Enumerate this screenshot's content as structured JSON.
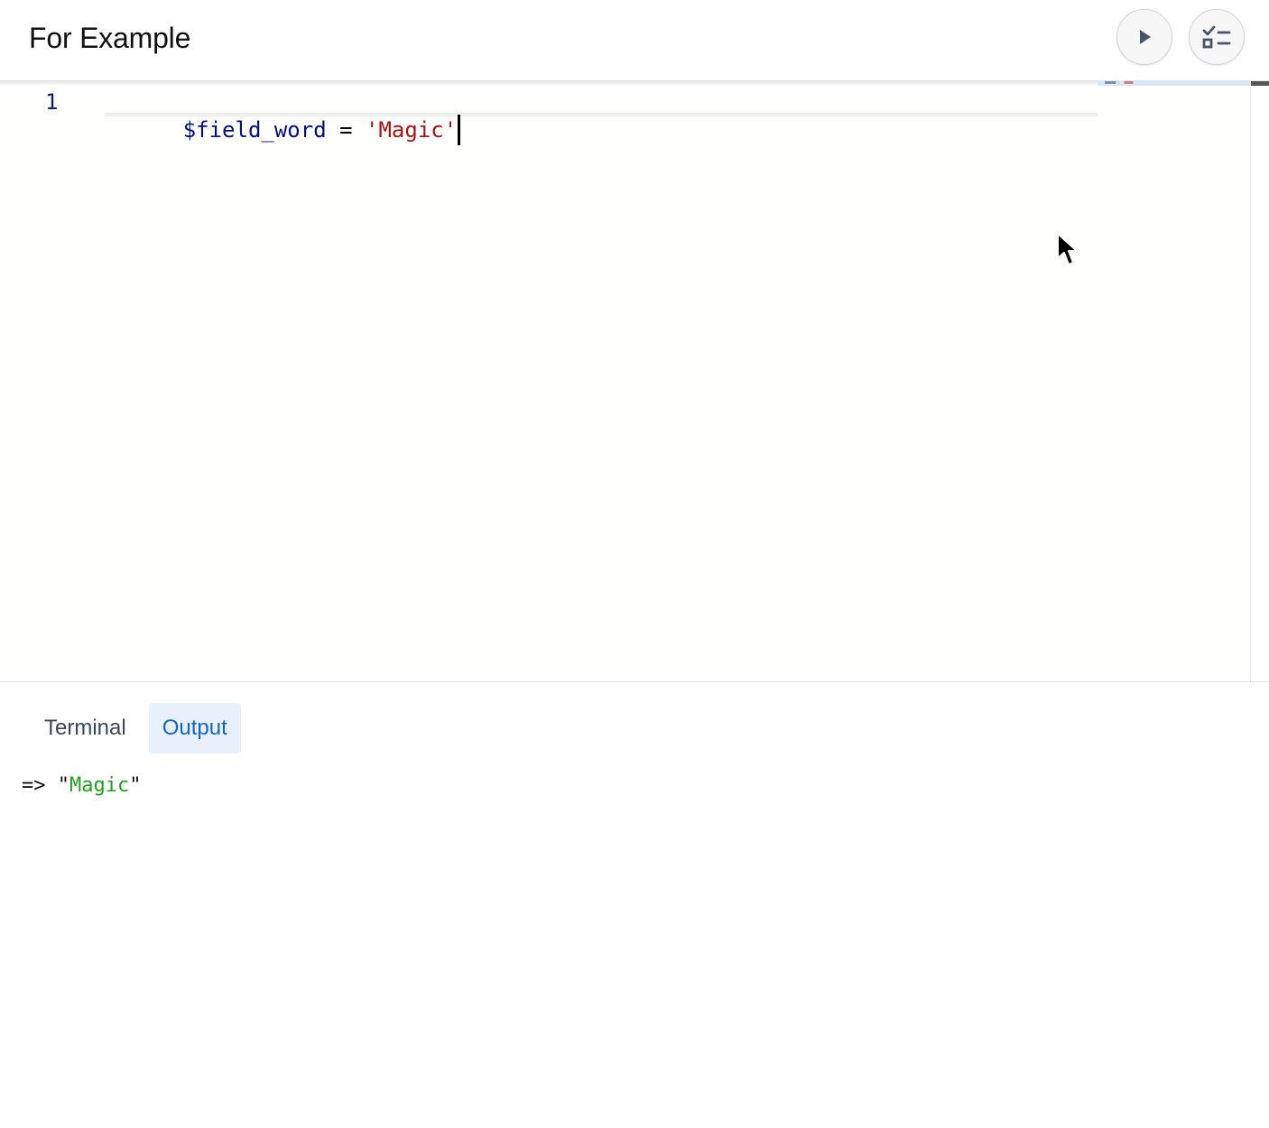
{
  "header": {
    "title": "For Example",
    "run_icon": "play-icon",
    "tests_icon": "checklist-icon"
  },
  "editor": {
    "line_numbers": [
      "1"
    ],
    "code": {
      "variable": "$field_word",
      "operator": " = ",
      "string": "'Magic'"
    }
  },
  "bottom_panel": {
    "tabs": [
      {
        "label": "Terminal",
        "active": false
      },
      {
        "label": "Output",
        "active": true
      }
    ],
    "output": {
      "prefix": "=> \"",
      "value": "Magic",
      "suffix": "\""
    }
  },
  "colors": {
    "accent": "#1565c0",
    "active_tab_background": "#e7f0fb",
    "code_variable": "#001080",
    "code_string": "#a31515",
    "output_string": "#21a021"
  }
}
